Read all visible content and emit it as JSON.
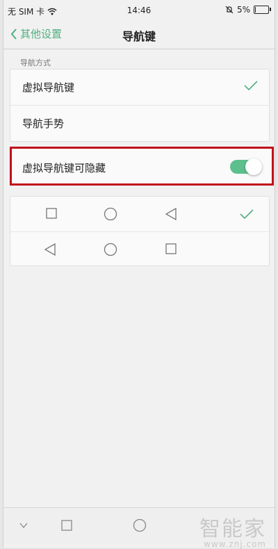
{
  "status_bar": {
    "carrier": "无 SIM 卡",
    "time": "14:46",
    "battery_text": "5%"
  },
  "header": {
    "back_label": "其他设置",
    "title": "导航键"
  },
  "section_label": "导航方式",
  "navigation_modes": [
    {
      "label": "虚拟导航键",
      "selected": true
    },
    {
      "label": "导航手势",
      "selected": false
    }
  ],
  "hide_option": {
    "label": "虚拟导航键可隐藏",
    "enabled": true
  },
  "layouts": [
    {
      "order": [
        "square-icon",
        "circle-icon",
        "triangle-left-icon"
      ],
      "selected": true
    },
    {
      "order": [
        "triangle-left-icon",
        "circle-icon",
        "square-icon"
      ],
      "selected": false
    }
  ],
  "colors": {
    "accent": "#4fb07f",
    "toggle_on": "#5cbf8c",
    "highlight_border": "#c00f1a"
  },
  "watermark": {
    "brand": "智能家",
    "url": "www.znj.com"
  }
}
